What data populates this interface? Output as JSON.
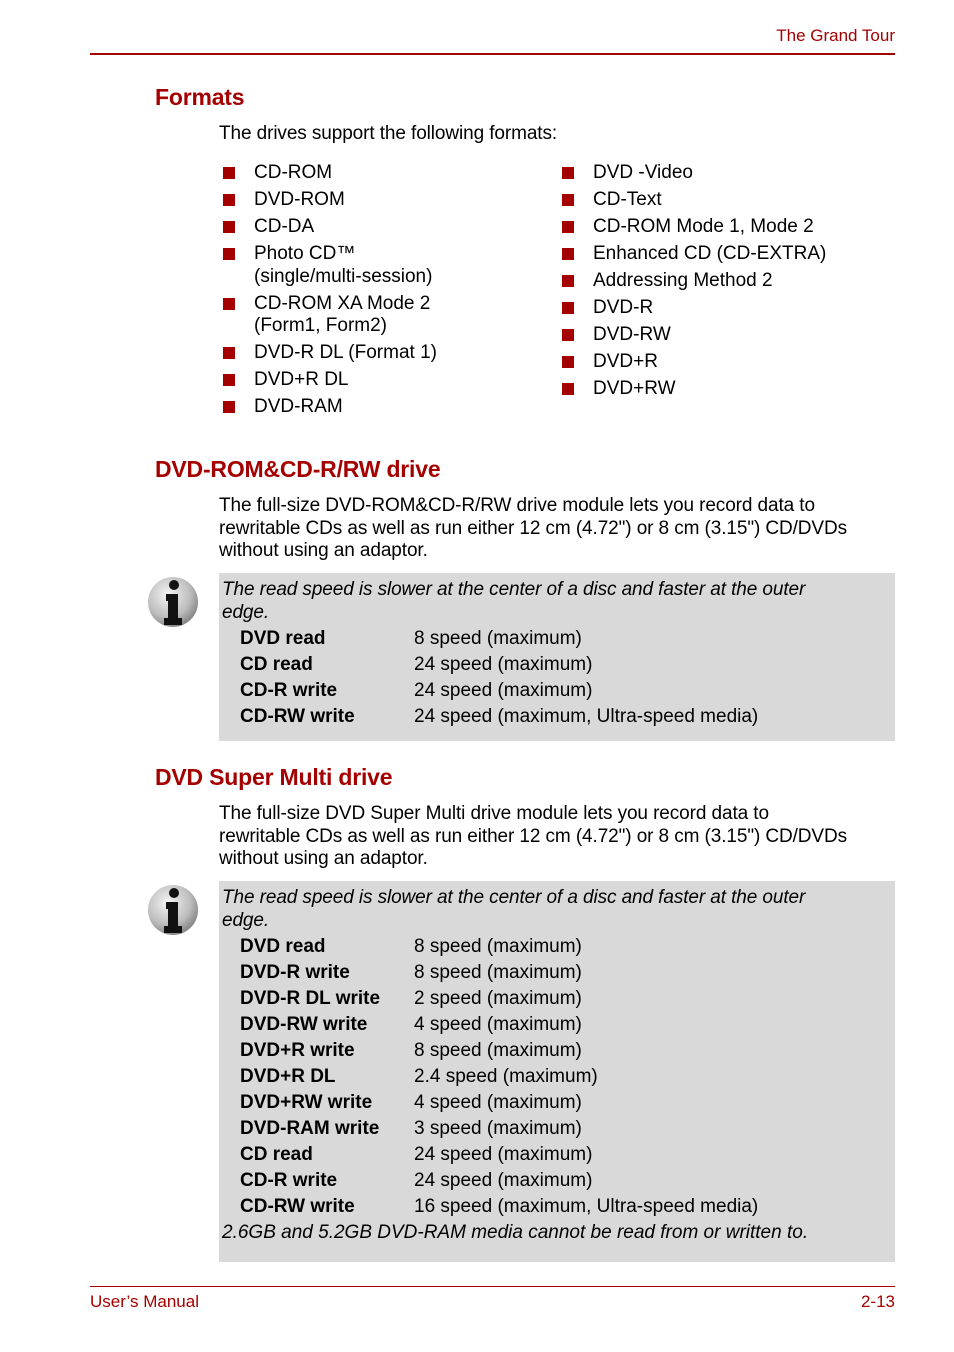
{
  "header": {
    "title": "The Grand Tour"
  },
  "footer": {
    "left": "User’s Manual",
    "page": "2-13"
  },
  "formats": {
    "heading": "Formats",
    "intro": "The drives support the following formats:",
    "left_items": [
      "CD-ROM",
      "DVD-ROM",
      "CD-DA",
      "Photo CD™ (single/multi-session)",
      "CD-ROM XA Mode 2 (Form1, Form2)",
      "DVD-R DL (Format 1)",
      "DVD+R DL",
      "DVD-RAM"
    ],
    "left_items_lines": [
      [
        "CD-ROM"
      ],
      [
        "DVD-ROM"
      ],
      [
        "CD-DA"
      ],
      [
        "Photo CD™",
        "(single/multi-session)"
      ],
      [
        "CD-ROM XA Mode 2",
        "(Form1, Form2)"
      ],
      [
        "DVD-R DL (Format 1)"
      ],
      [
        "DVD+R DL"
      ],
      [
        "DVD-RAM"
      ]
    ],
    "right_items": [
      "DVD -Video",
      "CD-Text",
      "CD-ROM Mode 1, Mode 2",
      "Enhanced CD (CD-EXTRA)",
      "Addressing Method 2",
      "DVD-R",
      "DVD-RW",
      "DVD+R",
      "DVD+RW"
    ]
  },
  "dvdrom_section": {
    "heading": "DVD-ROM&CD-R/RW drive",
    "paragraph_lines": [
      "The full-size DVD-ROM&CD-R/RW drive module lets you record data to",
      "rewritable CDs as well as run either 12 cm (4.72\") or 8 cm (3.15\") CD/DVDs",
      "without using an adaptor."
    ],
    "note": {
      "icon": "info-icon",
      "text_lines": [
        "The read speed is slower at the center of a disc and faster at the outer",
        "edge."
      ],
      "rows": [
        {
          "label": "DVD read",
          "value": "8 speed (maximum)"
        },
        {
          "label": "CD read",
          "value": "24 speed (maximum)"
        },
        {
          "label": "CD-R write",
          "value": "24 speed (maximum)"
        },
        {
          "label": "CD-RW write",
          "value": "24 speed (maximum, Ultra-speed media)"
        }
      ]
    }
  },
  "supermulti_section": {
    "heading": "DVD Super Multi drive",
    "paragraph_lines": [
      "The full-size DVD Super Multi drive module lets you record data to",
      "rewritable CDs as well as run either 12 cm (4.72\") or 8 cm (3.15\") CD/DVDs",
      "without using an adaptor."
    ],
    "note": {
      "icon": "info-icon",
      "text_lines": [
        "The read speed is slower at the center of a disc and faster at the outer",
        "edge."
      ],
      "rows": [
        {
          "label": "DVD read",
          "value": "8 speed (maximum)"
        },
        {
          "label": "DVD-R write",
          "value": "8 speed (maximum)"
        },
        {
          "label": "DVD-R DL write",
          "value": "2 speed (maximum)"
        },
        {
          "label": "DVD-RW write",
          "value": "4 speed (maximum)"
        },
        {
          "label": "DVD+R write",
          "value": "8 speed (maximum)"
        },
        {
          "label": "DVD+R DL",
          "value": "2.4 speed (maximum)"
        },
        {
          "label": "DVD+RW write",
          "value": "4 speed (maximum)"
        },
        {
          "label": "DVD-RAM write",
          "value": "3 speed (maximum)"
        },
        {
          "label": "CD read",
          "value": "24 speed (maximum)"
        },
        {
          "label": "CD-R write",
          "value": "24 speed (maximum)"
        },
        {
          "label": "CD-RW write",
          "value": "16 speed (maximum, Ultra-speed media)"
        }
      ],
      "footnote": "2.6GB and 5.2GB DVD-RAM media cannot be read from or written to."
    }
  },
  "colors": {
    "accent": "#a50000",
    "note_background": "#d9d9d9"
  }
}
